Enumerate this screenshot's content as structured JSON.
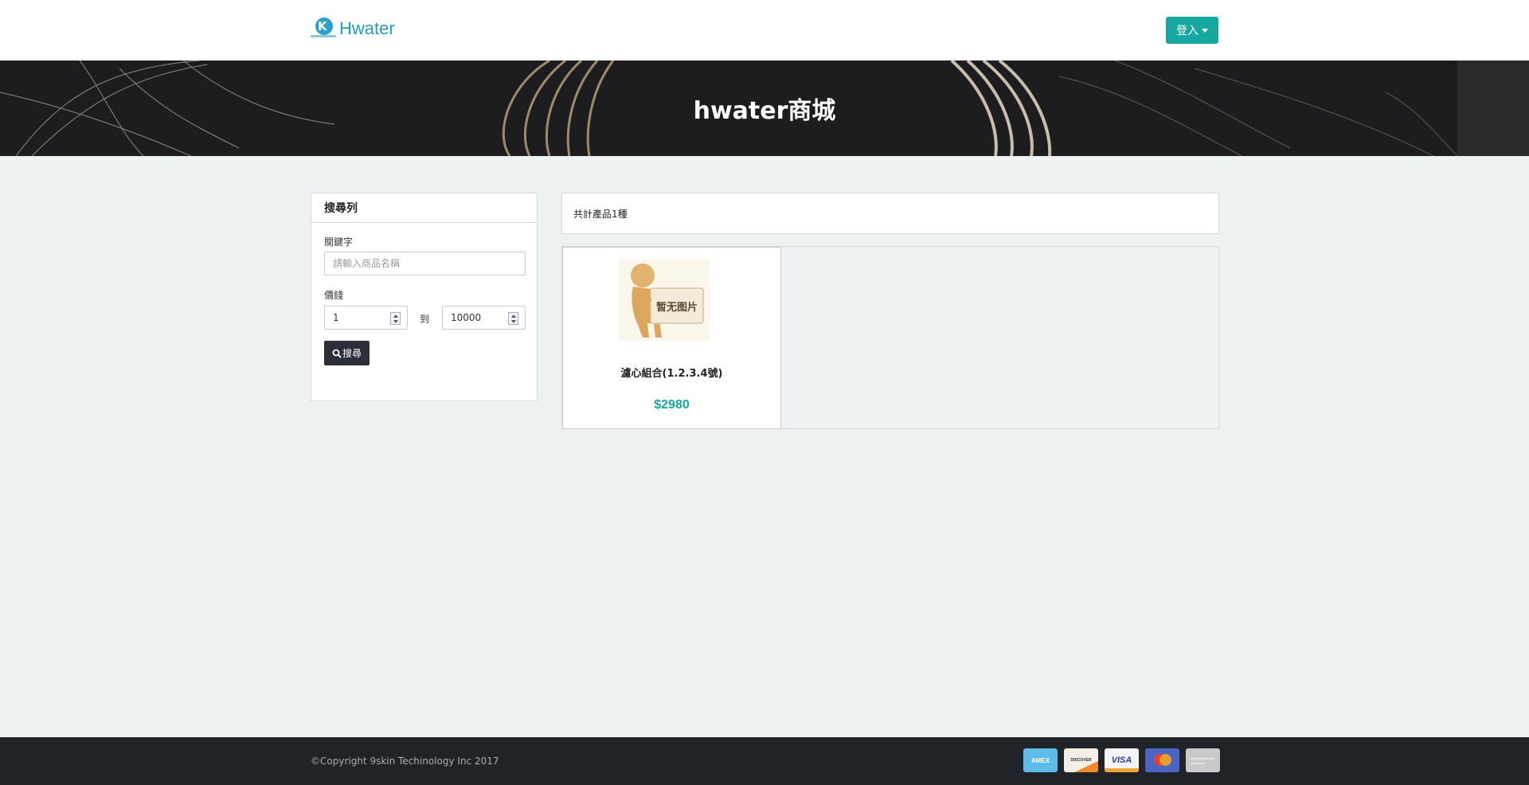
{
  "header": {
    "brand": "Hwater",
    "login_label": "登入"
  },
  "hero": {
    "title": "hwater商城"
  },
  "search_panel": {
    "title": "搜尋列",
    "keyword_label": "關鍵字",
    "keyword_placeholder": "請輸入商品名稱",
    "keyword_value": "",
    "price_label": "價錢",
    "price_min": "1",
    "price_to": "到",
    "price_max": "10000",
    "search_label": "搜尋"
  },
  "results": {
    "count_text": "共計產品1種",
    "products": [
      {
        "image_text": "暂无图片",
        "name": "濾心組合(1.2.3.4號)",
        "price": "$2980"
      }
    ]
  },
  "footer": {
    "copyright": "©Copyright 9skin Techinology Inc 2017",
    "payment_methods": [
      {
        "name": "AMEX",
        "icon": "amex-card-icon"
      },
      {
        "name": "DISCOVER",
        "icon": "discover-card-icon"
      },
      {
        "name": "VISA",
        "icon": "visa-card-icon"
      },
      {
        "name": "",
        "icon": "mastercard-icon"
      },
      {
        "name": "",
        "icon": "generic-card-icon"
      }
    ]
  },
  "colors": {
    "accent": "#16a8a0",
    "price": "#1aa59d",
    "footer_bg": "#202327",
    "page_bg": "#eef1f2",
    "dark_button": "#2a3036"
  }
}
